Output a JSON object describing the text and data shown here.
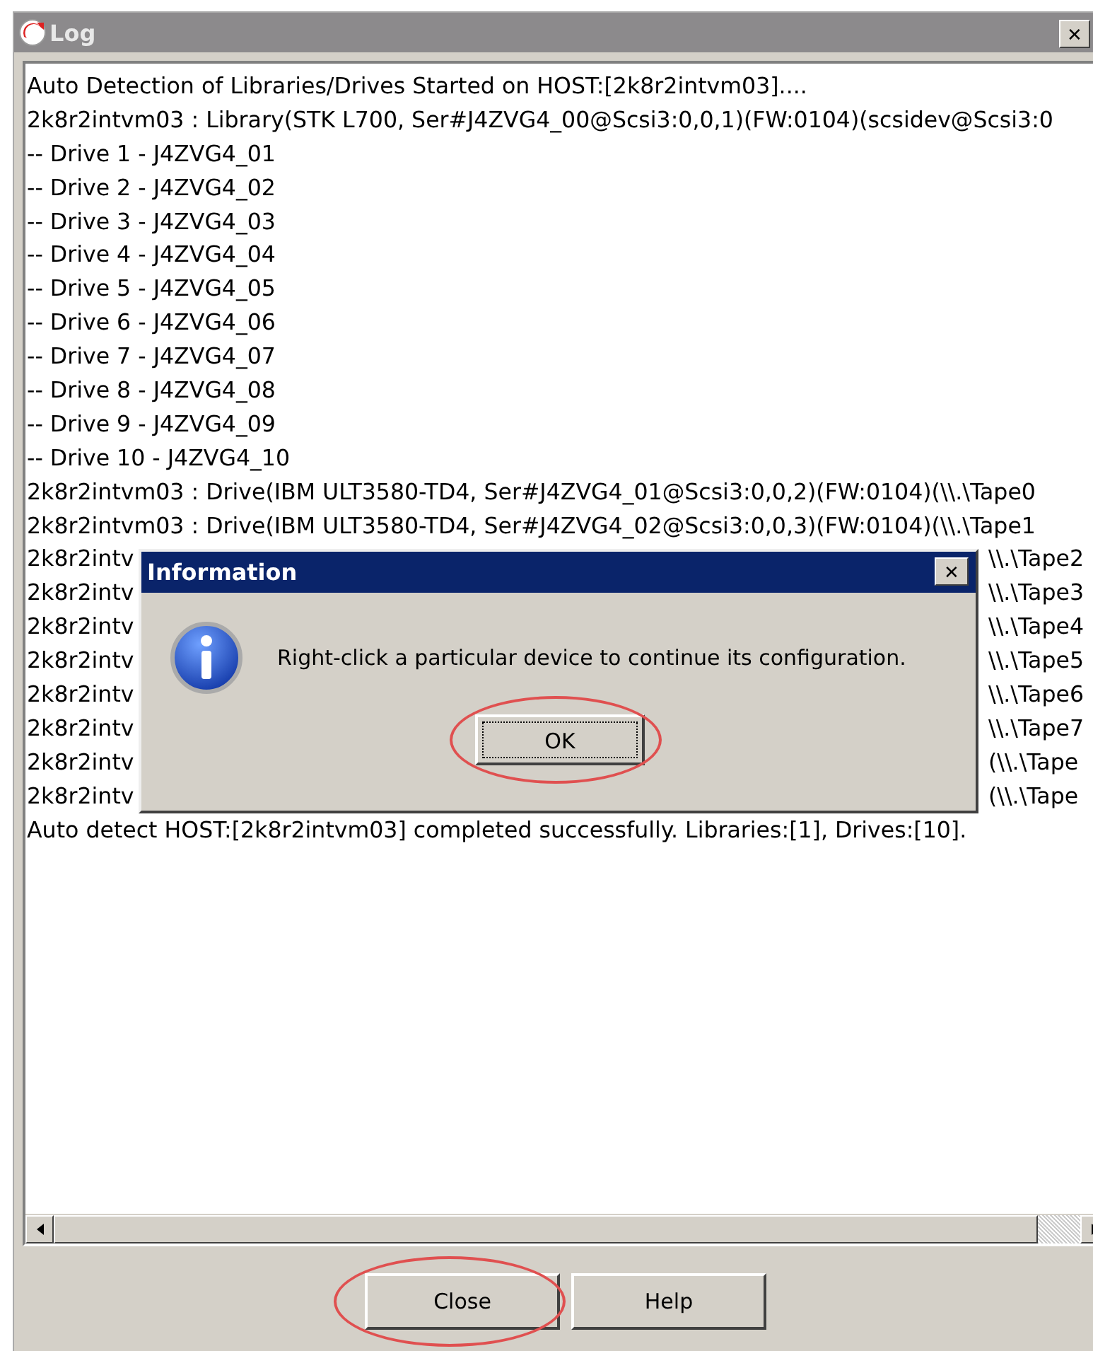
{
  "window": {
    "title": "Log",
    "close_glyph": "✕"
  },
  "log_lines": [
    {
      "kind": "full",
      "text": "Auto Detection of Libraries/Drives Started on HOST:[2k8r2intvm03]...."
    },
    {
      "kind": "full",
      "text": "2k8r2intvm03 : Library(STK L700, Ser#J4ZVG4_00@Scsi3:0,0,1)(FW:0104)(scsidev@Scsi3:0"
    },
    {
      "kind": "full",
      "text": "-- Drive 1 - J4ZVG4_01"
    },
    {
      "kind": "full",
      "text": "-- Drive 2 - J4ZVG4_02"
    },
    {
      "kind": "full",
      "text": "-- Drive 3 - J4ZVG4_03"
    },
    {
      "kind": "full",
      "text": "-- Drive 4 - J4ZVG4_04"
    },
    {
      "kind": "full",
      "text": "-- Drive 5 - J4ZVG4_05"
    },
    {
      "kind": "full",
      "text": "-- Drive 6 - J4ZVG4_06"
    },
    {
      "kind": "full",
      "text": "-- Drive 7 - J4ZVG4_07"
    },
    {
      "kind": "full",
      "text": "-- Drive 8 - J4ZVG4_08"
    },
    {
      "kind": "full",
      "text": "-- Drive 9 - J4ZVG4_09"
    },
    {
      "kind": "full",
      "text": "-- Drive 10 - J4ZVG4_10"
    },
    {
      "kind": "full",
      "text": "2k8r2intvm03 : Drive(IBM ULT3580-TD4, Ser#J4ZVG4_01@Scsi3:0,0,2)(FW:0104)(\\\\.\\Tape0"
    },
    {
      "kind": "full",
      "text": "2k8r2intvm03 : Drive(IBM ULT3580-TD4, Ser#J4ZVG4_02@Scsi3:0,0,3)(FW:0104)(\\\\.\\Tape1"
    },
    {
      "kind": "split",
      "start": "2k8r2intv",
      "end": "\\\\.\\Tape2"
    },
    {
      "kind": "split",
      "start": "2k8r2intv",
      "end": "\\\\.\\Tape3"
    },
    {
      "kind": "split",
      "start": "2k8r2intv",
      "end": "\\\\.\\Tape4"
    },
    {
      "kind": "split",
      "start": "2k8r2intv",
      "end": "\\\\.\\Tape5"
    },
    {
      "kind": "split",
      "start": "2k8r2intv",
      "end": "\\\\.\\Tape6"
    },
    {
      "kind": "split",
      "start": "2k8r2intv",
      "end": "\\\\.\\Tape7"
    },
    {
      "kind": "split",
      "start": "2k8r2intv",
      "end": "(\\\\.\\Tape"
    },
    {
      "kind": "split",
      "start": "2k8r2intv",
      "end": "(\\\\.\\Tape"
    },
    {
      "kind": "full",
      "text": "Auto detect HOST:[2k8r2intvm03] completed successfully. Libraries:[1], Drives:[10]."
    }
  ],
  "buttons": [
    {
      "label": "Close",
      "highlighted": true
    },
    {
      "label": "Help",
      "highlighted": false
    }
  ],
  "dialog": {
    "title": "Information",
    "close_glyph": "✕",
    "message": "Right-click a particular device to continue its configuration.",
    "button": {
      "label": "OK",
      "highlighted": true
    }
  }
}
